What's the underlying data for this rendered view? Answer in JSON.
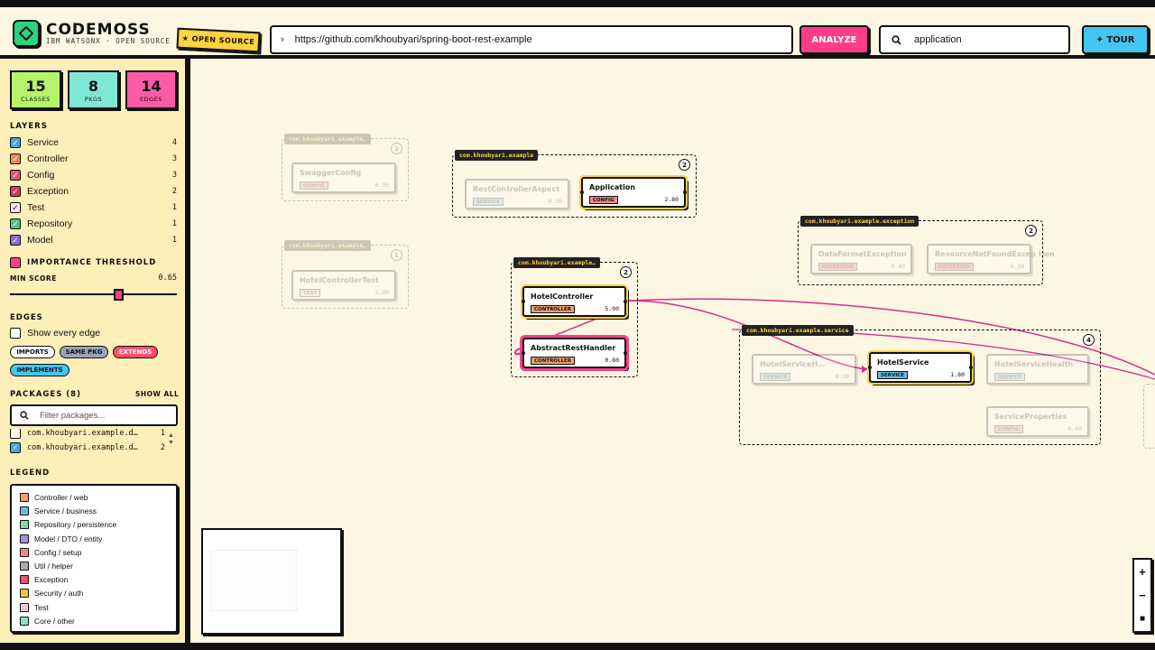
{
  "header": {
    "brand": "CODEMOSS",
    "subtitle": "IBM WATSONX · OPEN SOURCE",
    "badge": "★ OPEN SOURCE",
    "url": "https://github.com/khoubyari/spring-boot-rest-example",
    "analyze_label": "ANALYZE",
    "search_value": "application",
    "tour_label": "✦ TOUR"
  },
  "stats": [
    {
      "value": "15",
      "label": "CLASSES",
      "color": "#b7f26a"
    },
    {
      "value": "8",
      "label": "PKGS",
      "color": "#7ee8d6"
    },
    {
      "value": "14",
      "label": "EDGES",
      "color": "#ff5aa5"
    }
  ],
  "layers": {
    "title": "LAYERS",
    "items": [
      {
        "label": "Service",
        "count": "4",
        "color": "#43a7e8"
      },
      {
        "label": "Controller",
        "count": "3",
        "color": "#f0884b"
      },
      {
        "label": "Config",
        "count": "3",
        "color": "#e5556b"
      },
      {
        "label": "Exception",
        "count": "2",
        "color": "#d83a52"
      },
      {
        "label": "Test",
        "count": "1",
        "color": "#fbe6ef"
      },
      {
        "label": "Repository",
        "count": "1",
        "color": "#4cc48a"
      },
      {
        "label": "Model",
        "count": "1",
        "color": "#8b6bd9"
      }
    ]
  },
  "importance": {
    "title": "IMPORTANCE THRESHOLD",
    "min_label": "MIN SCORE",
    "min_value": "0.65",
    "slider_fraction": 0.65
  },
  "edges": {
    "title": "EDGES",
    "show_all": "Show every edge",
    "chips": [
      {
        "label": "IMPORTS",
        "color": "#fff"
      },
      {
        "label": "SAME PKG",
        "color": "#9aa3b8"
      },
      {
        "label": "EXTENDS",
        "color": "#ff4f6d"
      },
      {
        "label": "IMPLEMENTS",
        "color": "#43c6ef"
      }
    ]
  },
  "packages": {
    "title": "PACKAGES (8)",
    "show_all": "SHOW ALL",
    "filter_placeholder": "Filter packages...",
    "items": [
      {
        "label": "com.khoubyari.example.d…",
        "count": "1"
      },
      {
        "label": "com.khoubyari.example.d…",
        "count": "2"
      }
    ]
  },
  "legend": {
    "title": "LEGEND",
    "items": [
      {
        "label": "Controller / web",
        "color": "#f0a070"
      },
      {
        "label": "Service / business",
        "color": "#6ab8e8"
      },
      {
        "label": "Repository / persistence",
        "color": "#8ad89a"
      },
      {
        "label": "Model / DTO / entity",
        "color": "#a98ee0"
      },
      {
        "label": "Config / setup",
        "color": "#ef8a8a"
      },
      {
        "label": "Util / helper",
        "color": "#a8acb4"
      },
      {
        "label": "Exception",
        "color": "#e5556b"
      },
      {
        "label": "Security / auth",
        "color": "#f4c24a"
      },
      {
        "label": "Test",
        "color": "#f6c9d6"
      },
      {
        "label": "Core / other",
        "color": "#8de0cc"
      }
    ]
  },
  "graph": {
    "packages": [
      {
        "label": "com.khoubyari.example…",
        "count": "1"
      },
      {
        "label": "com.khoubyari.example",
        "count": "2"
      },
      {
        "label": "com.khoubyari.example…",
        "count": "1"
      },
      {
        "label": "com.khoubyari.example…",
        "count": "2"
      },
      {
        "label": "com.khoubyari.example.exception",
        "count": "2"
      },
      {
        "label": "com.khoubyari.example.service",
        "count": "4"
      }
    ],
    "nodes": [
      {
        "name": "SwaggerConfig",
        "tag": "CONFIG",
        "score": "0.30",
        "tagcolor": "#ef8a8a"
      },
      {
        "name": "RestControllerAspect",
        "tag": "SERVICE",
        "score": "0.30",
        "tagcolor": "#6ab8e8"
      },
      {
        "name": "Application",
        "tag": "CONFIG",
        "score": "2.80",
        "tagcolor": "#ef8a8a"
      },
      {
        "name": "HotelControllerTest",
        "tag": "TEST",
        "score": "2.00",
        "tagcolor": "#f6c9d6"
      },
      {
        "name": "HotelController",
        "tag": "CONTROLLER",
        "score": "5.00",
        "tagcolor": "#f0a070"
      },
      {
        "name": "AbstractRestHandler",
        "tag": "CONTROLLER",
        "score": "0.80",
        "tagcolor": "#f0a070"
      },
      {
        "name": "DataFormatException",
        "tag": "EXCEPTION",
        "score": "0.40",
        "tagcolor": "#e5556b"
      },
      {
        "name": "ResourceNotFoundExcep tion",
        "tag": "EXCEPTION",
        "score": "0.30",
        "tagcolor": "#e5556b"
      },
      {
        "name": "HotelServiceH…",
        "tag": "SERVICE",
        "score": "0.30",
        "tagcolor": "#6ab8e8"
      },
      {
        "name": "HotelService",
        "tag": "SERVICE",
        "score": "1.80",
        "tagcolor": "#6ab8e8"
      },
      {
        "name": "HotelServiceHealth",
        "tag": "SERVICE",
        "score": "",
        "tagcolor": "#6ab8e8"
      },
      {
        "name": "ServiceProperties",
        "tag": "CONFIG",
        "score": "0.40",
        "tagcolor": "#ef8a8a"
      }
    ]
  }
}
